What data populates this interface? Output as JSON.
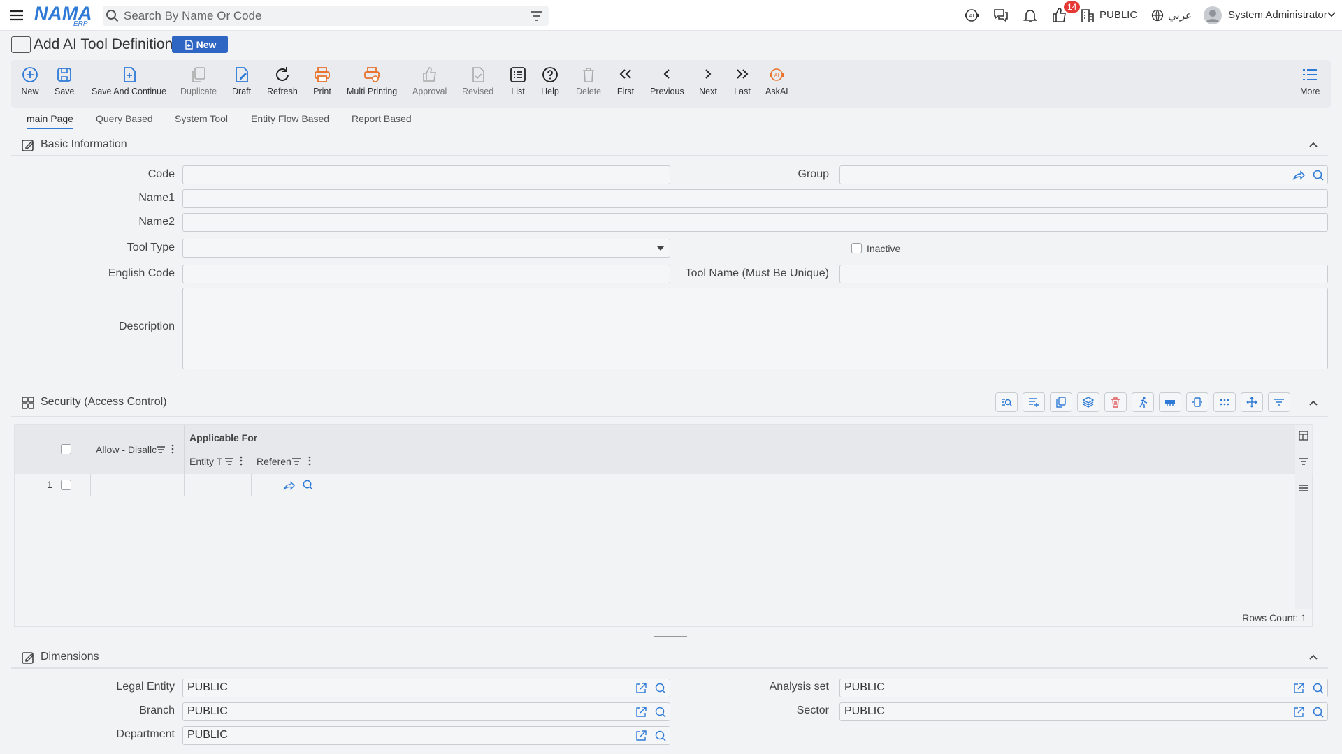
{
  "header": {
    "search_placeholder": "Search By Name Or Code",
    "notification_count": "14",
    "company": "PUBLIC",
    "language": "عربي",
    "user": "System Administrator"
  },
  "page": {
    "title": "Add AI Tool Definition",
    "status_badge": "New"
  },
  "toolbar": {
    "new": "New",
    "save": "Save",
    "save_continue": "Save And Continue",
    "duplicate": "Duplicate",
    "draft": "Draft",
    "refresh": "Refresh",
    "print": "Print",
    "multi_printing": "Multi Printing",
    "approval": "Approval",
    "revised": "Revised",
    "list": "List",
    "help": "Help",
    "delete": "Delete",
    "first": "First",
    "previous": "Previous",
    "next": "Next",
    "last": "Last",
    "askai": "AskAI",
    "more": "More"
  },
  "tabs": [
    "main Page",
    "Query Based",
    "System Tool",
    "Entity Flow Based",
    "Report Based"
  ],
  "basic_info": {
    "title": "Basic Information",
    "code_label": "Code",
    "group_label": "Group",
    "name1_label": "Name1",
    "name2_label": "Name2",
    "tool_type_label": "Tool Type",
    "inactive_label": "Inactive",
    "english_code_label": "English Code",
    "tool_name_label": "Tool Name (Must Be Unique)",
    "description_label": "Description"
  },
  "security": {
    "title": "Security (Access Control)",
    "col_allow": "Allow - Disallc",
    "group_applicable": "Applicable For",
    "col_entity": "Entity T",
    "col_reference": "Referen",
    "row_number": "1",
    "rows_count": "Rows Count: 1"
  },
  "dimensions": {
    "title": "Dimensions",
    "legal_entity_label": "Legal Entity",
    "legal_entity_value": "PUBLIC",
    "analysis_set_label": "Analysis set",
    "analysis_set_value": "PUBLIC",
    "branch_label": "Branch",
    "branch_value": "PUBLIC",
    "sector_label": "Sector",
    "sector_value": "PUBLIC",
    "department_label": "Department",
    "department_value": "PUBLIC"
  },
  "colors": {
    "brand": "#2f7ad6",
    "badge_red": "#e53935",
    "print_orange": "#e8722c",
    "delete_red": "#e05a5a"
  }
}
